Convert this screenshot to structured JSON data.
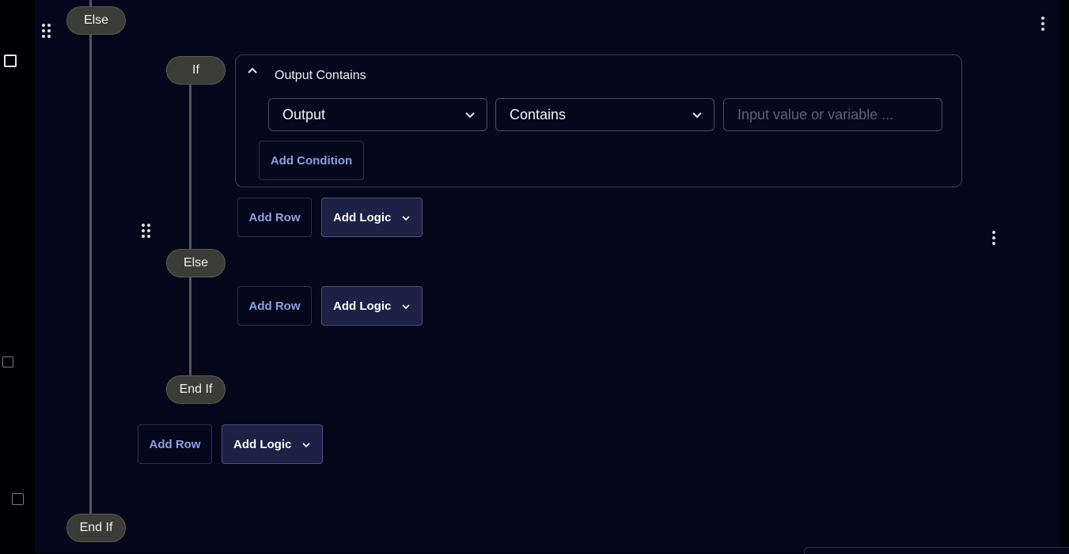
{
  "outer_branch": {
    "else_label": "Else",
    "end_if_label": "End If",
    "add_row_label": "Add Row",
    "add_logic_label": "Add Logic"
  },
  "inner_branch": {
    "if_label": "If",
    "else_label": "Else",
    "end_if_label": "End If",
    "condition": {
      "title": "Output Contains",
      "field_value": "Output",
      "operator_value": "Contains",
      "value_placeholder": "Input value or variable ...",
      "value": "",
      "add_condition_label": "Add Condition"
    },
    "if_actions": {
      "add_row_label": "Add Row",
      "add_logic_label": "Add Logic"
    },
    "else_actions": {
      "add_row_label": "Add Row",
      "add_logic_label": "Add Logic"
    }
  },
  "icons": {
    "drag_handle": "drag-handle-icon",
    "more_menu": "more-vertical-icon",
    "collapse": "chevron-up-icon",
    "dropdown": "chevron-down-icon",
    "checkbox": "checkbox-icon"
  },
  "colors": {
    "background": "#04061a",
    "pill": "#3b3c38",
    "connector": "#55565e",
    "primary_button": "#1c2145",
    "link_text": "#8ea0e0"
  }
}
